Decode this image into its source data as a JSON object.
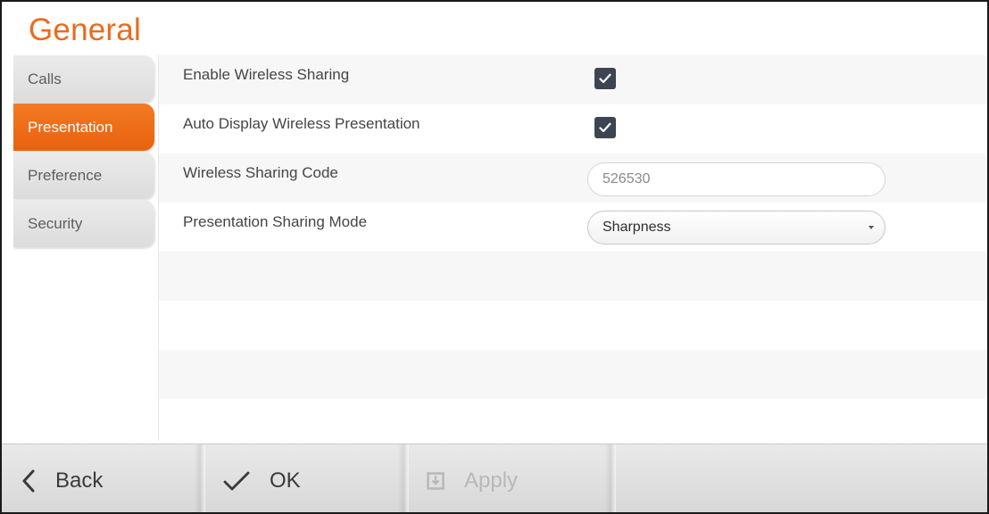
{
  "header": {
    "title": "General"
  },
  "sidebar": {
    "items": [
      {
        "label": "Calls",
        "active": false
      },
      {
        "label": "Presentation",
        "active": true
      },
      {
        "label": "Preference",
        "active": false
      },
      {
        "label": "Security",
        "active": false
      }
    ]
  },
  "settings": {
    "enable_wireless_sharing": {
      "label": "Enable Wireless Sharing",
      "checked": true
    },
    "auto_display": {
      "label": "Auto Display Wireless Presentation",
      "checked": true
    },
    "sharing_code": {
      "label": "Wireless Sharing Code",
      "value": "526530"
    },
    "sharing_mode": {
      "label": "Presentation Sharing Mode",
      "value": "Sharpness"
    }
  },
  "footer": {
    "back_label": "Back",
    "ok_label": "OK",
    "apply_label": "Apply"
  },
  "colors": {
    "accent": "#ec6a1c",
    "checkbox": "#3d4552"
  },
  "icons": {
    "back": "chevron-left-icon",
    "ok": "checkmark-icon",
    "apply": "save-icon",
    "dropdown": "caret-down-icon",
    "checkbox": "check-icon"
  }
}
